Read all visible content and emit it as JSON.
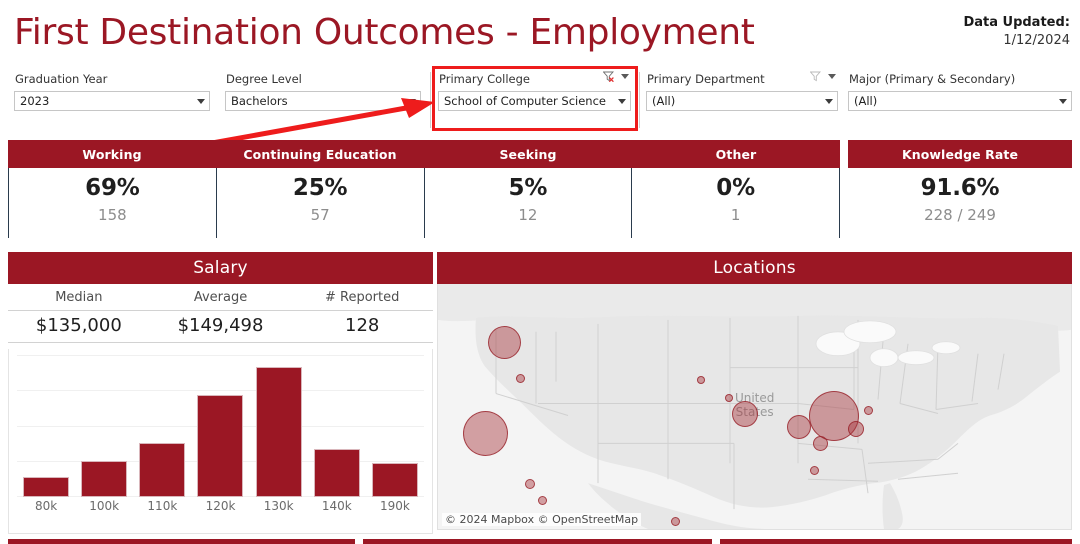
{
  "header": {
    "title": "First Destination Outcomes - Employment",
    "updated_label": "Data Updated:",
    "updated_value": "1/12/2024",
    "accent_color": "#9b1724",
    "highlight_color": "#ee1c1c"
  },
  "filters": [
    {
      "label": "Graduation Year",
      "value": "2023",
      "icon": "chevron-down-icon",
      "has_funnel": false,
      "funnel_active": false
    },
    {
      "label": "Degree Level",
      "value": "Bachelors",
      "icon": "chevron-down-icon",
      "has_funnel": false,
      "funnel_active": false
    },
    {
      "label": "Primary College",
      "value": "School of Computer Science",
      "icon": "chevron-down-icon",
      "has_funnel": true,
      "funnel_active": true
    },
    {
      "label": "Primary Department",
      "value": "(All)",
      "icon": "chevron-down-icon",
      "has_funnel": true,
      "funnel_active": false
    },
    {
      "label": "Major (Primary & Secondary)",
      "value": "(All)",
      "icon": "chevron-down-icon",
      "has_funnel": false,
      "funnel_active": false
    }
  ],
  "kpis": [
    {
      "label": "Working",
      "percent": "69%",
      "count": "158"
    },
    {
      "label": "Continuing Education",
      "percent": "25%",
      "count": "57"
    },
    {
      "label": "Seeking",
      "percent": "5%",
      "count": "12"
    },
    {
      "label": "Other",
      "percent": "0%",
      "count": "1"
    }
  ],
  "knowledge_rate": {
    "label": "Knowledge Rate",
    "percent": "91.6%",
    "count": "228 / 249"
  },
  "salary": {
    "title": "Salary",
    "columns": [
      "Median",
      "Average",
      "# Reported"
    ],
    "values": [
      "$135,000",
      "$149,498",
      "128"
    ]
  },
  "locations": {
    "title": "Locations",
    "attribution": "© 2024 Mapbox © OpenStreetMap",
    "map_label": "United States"
  },
  "chart_data": {
    "type": "bar",
    "title": "Salary",
    "xlabel": "",
    "ylabel": "",
    "categories": [
      "80k",
      "100k",
      "110k",
      "120k",
      "130k",
      "140k",
      "190k"
    ],
    "values": [
      20,
      36,
      54,
      102,
      130,
      48,
      34
    ],
    "ylim": [
      0,
      142
    ],
    "grid": true,
    "legend": "none",
    "bar_color": "#9b1724"
  },
  "map_points": [
    {
      "name": "seattle",
      "left": 10.5,
      "top": 24.0,
      "size": 33
    },
    {
      "name": "portland",
      "left": 13.0,
      "top": 38.5,
      "size": 9
    },
    {
      "name": "bay-area",
      "left": 7.5,
      "top": 61.0,
      "size": 45
    },
    {
      "name": "los-angeles",
      "left": 14.5,
      "top": 81.5,
      "size": 10
    },
    {
      "name": "san-diego",
      "left": 16.5,
      "top": 88.5,
      "size": 9
    },
    {
      "name": "austin",
      "left": 37.5,
      "top": 97.0,
      "size": 9
    },
    {
      "name": "minneapolis",
      "left": 41.5,
      "top": 39.0,
      "size": 8
    },
    {
      "name": "milwaukee",
      "left": 46.0,
      "top": 46.5,
      "size": 8
    },
    {
      "name": "chicago",
      "left": 48.5,
      "top": 53.0,
      "size": 26
    },
    {
      "name": "cleveland",
      "left": 57.0,
      "top": 58.5,
      "size": 24
    },
    {
      "name": "pittsburgh",
      "left": 60.5,
      "top": 65.0,
      "size": 15
    },
    {
      "name": "new-york",
      "left": 62.5,
      "top": 54.0,
      "size": 50
    },
    {
      "name": "philadelphia",
      "left": 66.0,
      "top": 59.0,
      "size": 16
    },
    {
      "name": "boston",
      "left": 68.0,
      "top": 51.5,
      "size": 9
    },
    {
      "name": "raleigh",
      "left": 59.5,
      "top": 76.0,
      "size": 9
    }
  ],
  "bottom_panels": [
    {
      "name": "bottom-panel-1"
    },
    {
      "name": "bottom-panel-2"
    },
    {
      "name": "bottom-panel-3"
    }
  ]
}
